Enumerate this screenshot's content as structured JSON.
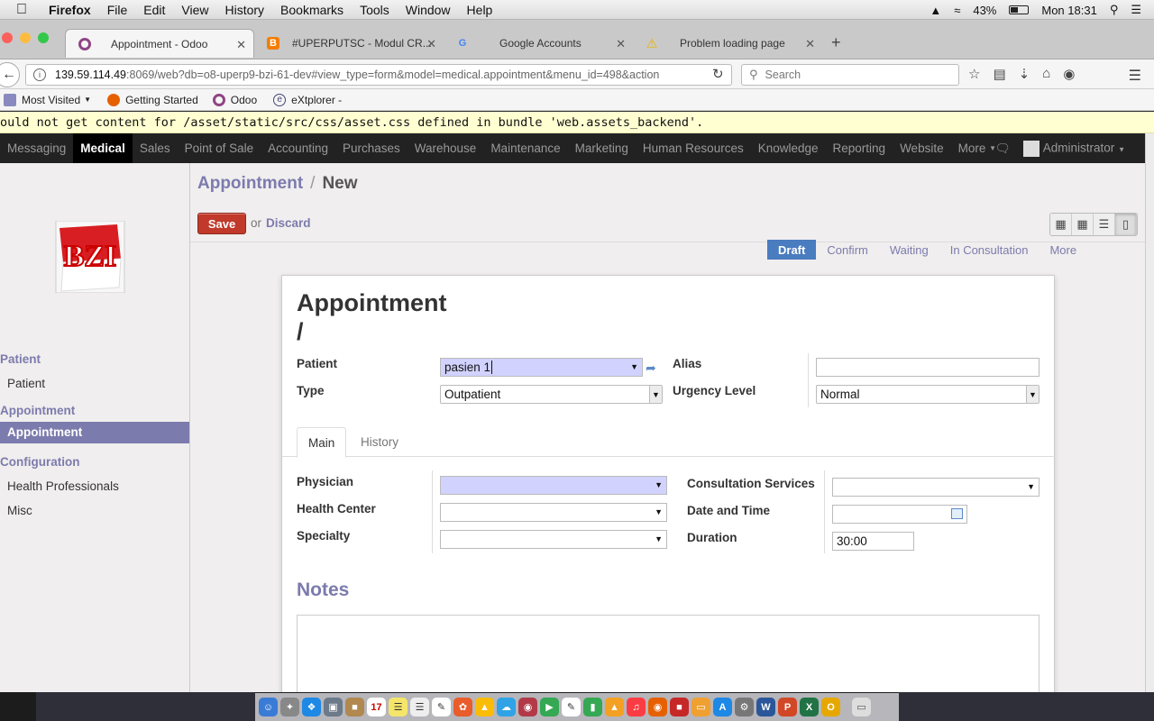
{
  "mac_menubar": {
    "app": "Firefox",
    "items": [
      "File",
      "Edit",
      "View",
      "History",
      "Bookmarks",
      "Tools",
      "Window",
      "Help"
    ],
    "battery": "43%",
    "clock": "Mon 18:31"
  },
  "tabs": [
    {
      "title": "Appointment - Odoo",
      "icon": "odoo-icon"
    },
    {
      "title": "#UPERPUTSC - Modul CR...",
      "icon": "blogger-icon"
    },
    {
      "title": "Google Accounts",
      "icon": "google-icon"
    },
    {
      "title": "Problem loading page",
      "icon": "warning-icon"
    }
  ],
  "navbar": {
    "url_host": "139.59.114.49",
    "url_rest": ":8069/web?db=o8-uperp9-bzi-61-dev#view_type=form&model=medical.appointment&menu_id=498&action",
    "search_placeholder": "Search"
  },
  "bookmarks": [
    "Most Visited",
    "Getting Started",
    "Odoo",
    "eXtplorer -"
  ],
  "warning_text": "ould not get content for /asset/static/src/css/asset.css defined in bundle 'web.assets_backend'.",
  "top_menu": {
    "items": [
      "Messaging",
      "Medical",
      "Sales",
      "Point of Sale",
      "Accounting",
      "Purchases",
      "Warehouse",
      "Maintenance",
      "Marketing",
      "Human Resources",
      "Knowledge",
      "Reporting",
      "Website",
      "More"
    ],
    "active": "Medical",
    "user": "Administrator"
  },
  "sidebar": {
    "sections": [
      {
        "header": "Patient",
        "items": [
          "Patient"
        ]
      },
      {
        "header": "Appointment",
        "items": [
          "Appointment"
        ]
      },
      {
        "header": "Configuration",
        "items": [
          "Health Professionals",
          "Misc"
        ]
      }
    ],
    "active_item": "Appointment"
  },
  "breadcrumb": {
    "parent": "Appointment",
    "current": "New"
  },
  "buttons": {
    "save": "Save",
    "or": "or",
    "discard": "Discard"
  },
  "statusbar": [
    "Draft",
    "Confirm",
    "Waiting",
    "In Consultation",
    "More"
  ],
  "form": {
    "title_line1": "Appointment",
    "title_line2": "/",
    "patient_label": "Patient",
    "patient_value": "pasien 1",
    "type_label": "Type",
    "type_value": "Outpatient",
    "alias_label": "Alias",
    "alias_value": "",
    "urgency_label": "Urgency Level",
    "urgency_value": "Normal",
    "tabs": [
      "Main",
      "History"
    ],
    "physician_label": "Physician",
    "health_center_label": "Health Center",
    "specialty_label": "Specialty",
    "consultation_label": "Consultation Services",
    "datetime_label": "Date and Time",
    "duration_label": "Duration",
    "duration_value": "30:00",
    "notes_label": "Notes"
  },
  "colors": {
    "accent": "#7c7bad",
    "save": "#c0392b",
    "status_active": "#4a7cc0",
    "required_field": "#d2d2ff"
  }
}
